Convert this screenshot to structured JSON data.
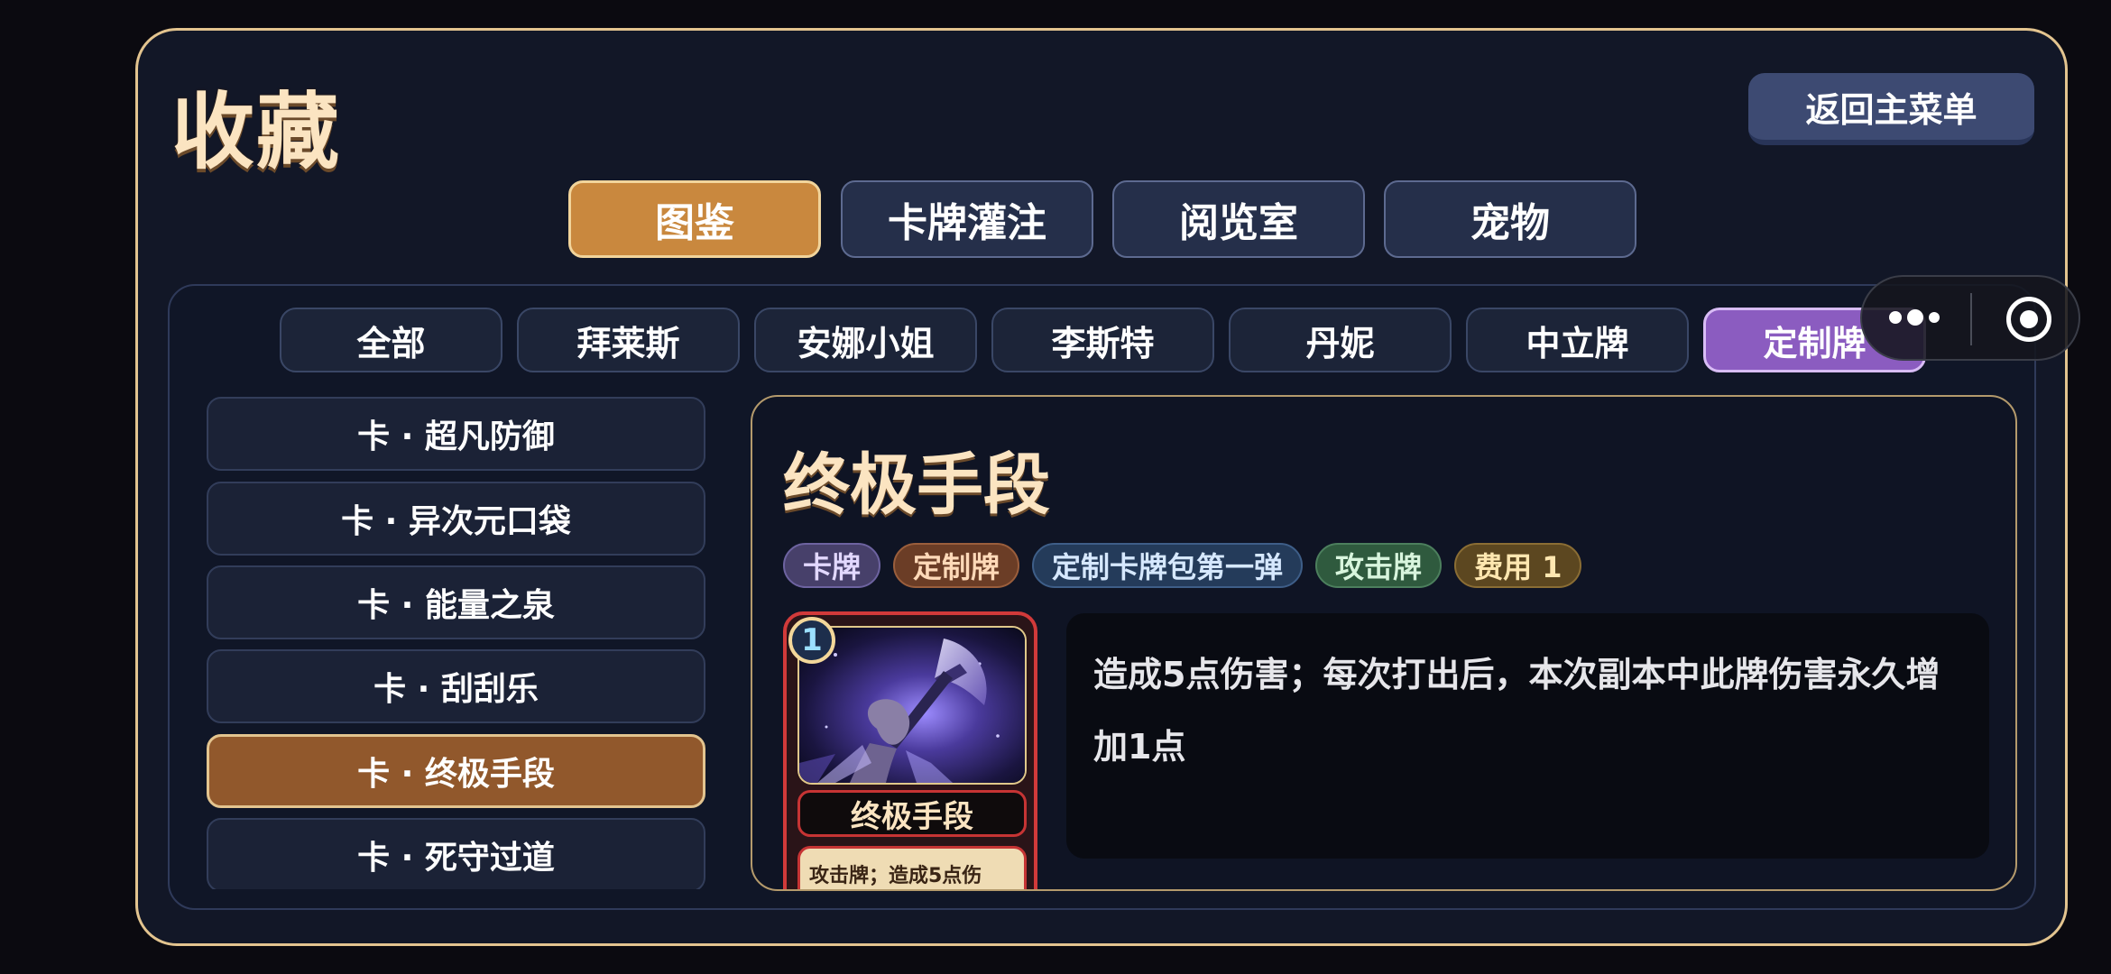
{
  "page": {
    "title": "收藏",
    "back_label": "返回主菜单"
  },
  "tabs": [
    {
      "label": "图鉴",
      "active": true
    },
    {
      "label": "卡牌灌注",
      "active": false
    },
    {
      "label": "阅览室",
      "active": false
    },
    {
      "label": "宠物",
      "active": false
    }
  ],
  "filters": [
    {
      "label": "全部"
    },
    {
      "label": "拜莱斯"
    },
    {
      "label": "安娜小姐"
    },
    {
      "label": "李斯特"
    },
    {
      "label": "丹妮"
    },
    {
      "label": "中立牌"
    },
    {
      "label": "定制牌",
      "active": true
    }
  ],
  "list": [
    {
      "label": "卡 · 超凡防御"
    },
    {
      "label": "卡 · 异次元口袋"
    },
    {
      "label": "卡 · 能量之泉"
    },
    {
      "label": "卡 · 刮刮乐"
    },
    {
      "label": "卡 · 终极手段",
      "active": true
    },
    {
      "label": "卡 · 死守过道"
    }
  ],
  "detail": {
    "title": "终极手段",
    "tags": [
      {
        "label": "卡牌",
        "bg": "#47406a",
        "fg": "#e2d8ff",
        "border": "#6d63a0"
      },
      {
        "label": "定制牌",
        "bg": "#6b3d26",
        "fg": "#ffd9b8",
        "border": "#9a5e3c"
      },
      {
        "label": "定制卡牌包第一弹",
        "bg": "#243b5a",
        "fg": "#d6e8ff",
        "border": "#3e5e88"
      },
      {
        "label": "攻击牌",
        "bg": "#2f5a3e",
        "fg": "#d8f5dd",
        "border": "#4c7f5d"
      },
      {
        "label": "费用 1",
        "bg": "#5c4720",
        "fg": "#ffe7b0",
        "border": "#8a6d34"
      }
    ],
    "card": {
      "cost": "1",
      "name": "终极手段",
      "text": "攻击牌；造成5点伤"
    },
    "description": "造成5点伤害；每次打出后，本次副本中此牌伤害永久增加1点"
  },
  "overlay": {
    "more_icon": "more-dots-icon",
    "close_icon": "target-icon"
  }
}
